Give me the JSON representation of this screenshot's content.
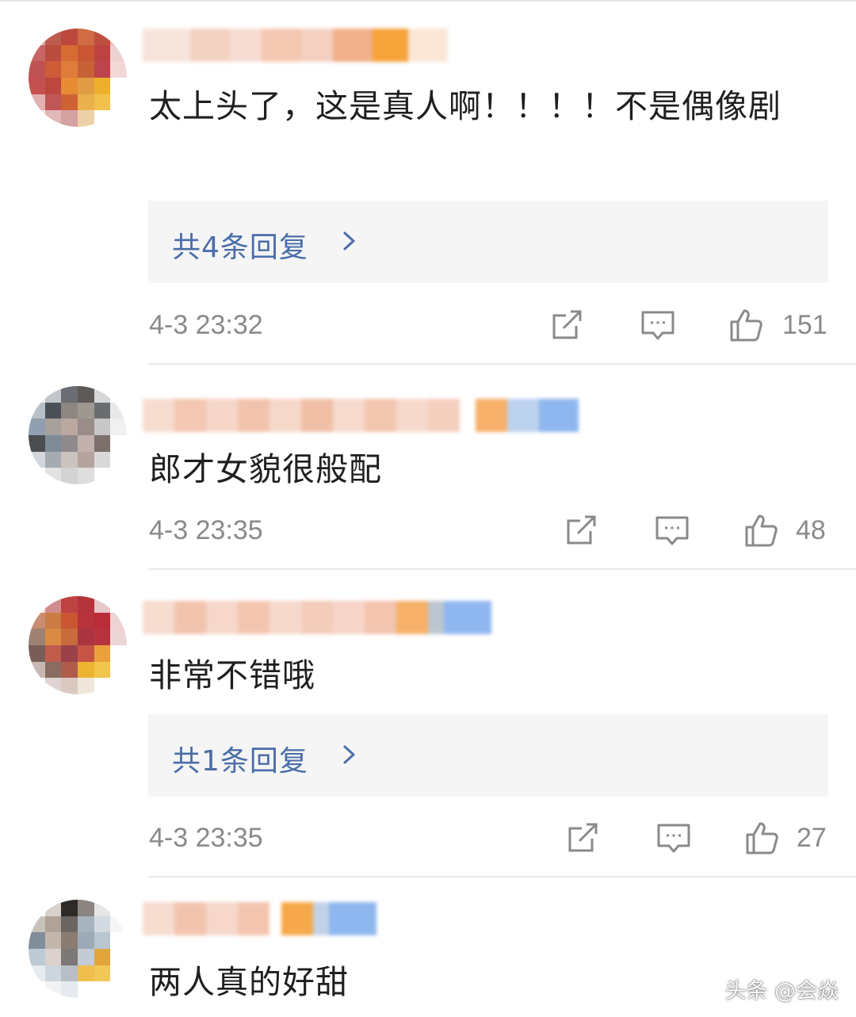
{
  "comments": [
    {
      "text": "太上头了，这是真人啊！！！！不是偶像剧",
      "replies_label": "共4条回复",
      "time": "4-3 23:32",
      "likes": "151"
    },
    {
      "text": "郎才女貌很般配",
      "time": "4-3 23:35",
      "likes": "48"
    },
    {
      "text": "非常不错哦",
      "replies_label": "共1条回复",
      "time": "4-3 23:35",
      "likes": "27"
    },
    {
      "text": "两人真的好甜"
    }
  ],
  "icons": {
    "share": "share-icon",
    "reply": "comment-icon",
    "like": "thumbs-up-icon",
    "replies_chevron": "chevron-right-icon"
  },
  "colors": {
    "reply_link": "#4a6ea9",
    "meta_text": "#8a8a8a",
    "reply_box_bg": "#f5f5f5",
    "divider": "#e8e8e8"
  },
  "watermark": "头条 @会焱"
}
